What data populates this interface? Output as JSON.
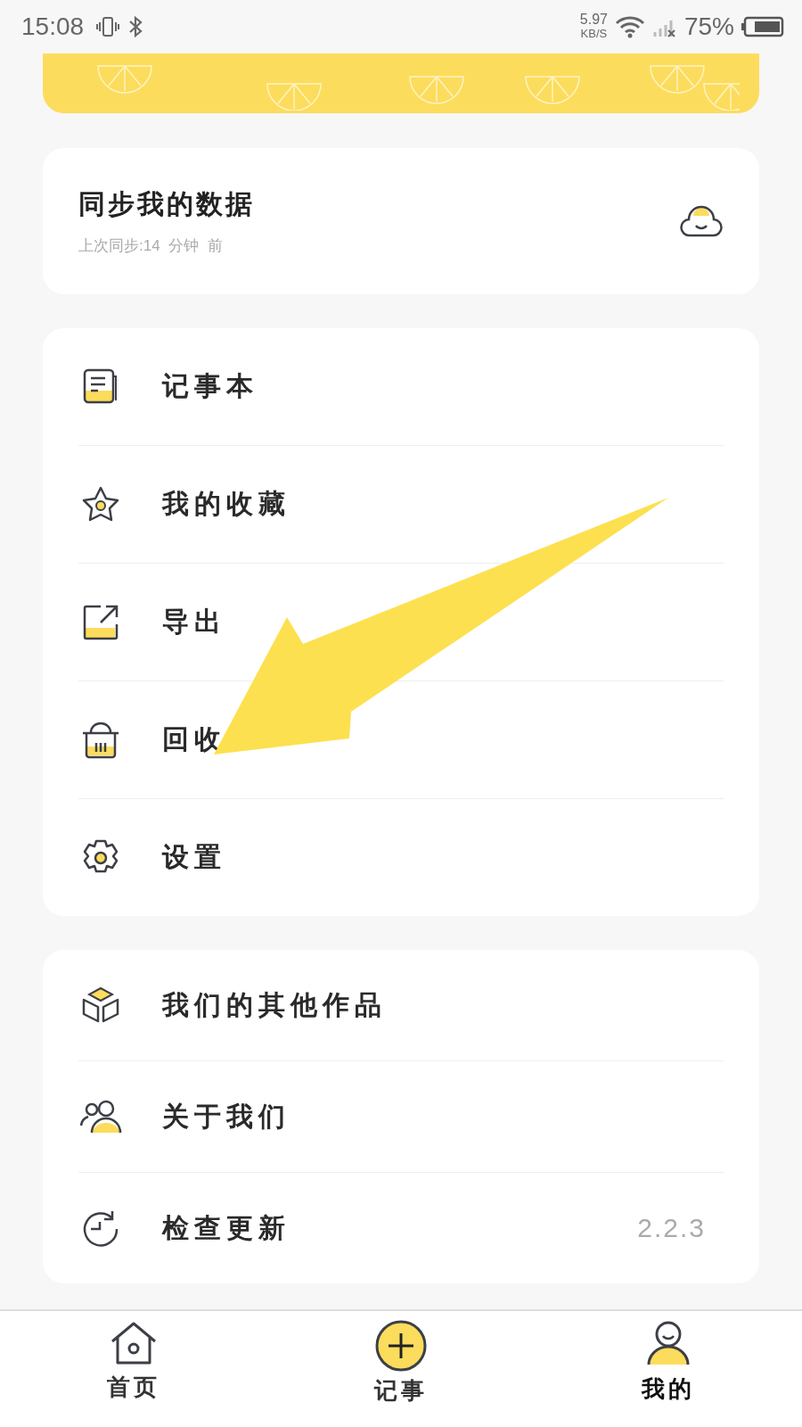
{
  "status_bar": {
    "time": "15:08",
    "net_speed": "5.97",
    "net_unit": "KB/S",
    "battery": "75%"
  },
  "sync_card": {
    "title": "同步我的数据",
    "subtitle": "上次同步:14  分钟  前"
  },
  "menu": [
    {
      "label": "记事本"
    },
    {
      "label": "我的收藏"
    },
    {
      "label": "导出"
    },
    {
      "label": "回收"
    },
    {
      "label": "设置"
    }
  ],
  "more_menu": [
    {
      "label": "我们的其他作品"
    },
    {
      "label": "关于我们"
    },
    {
      "label": "检查更新",
      "value": "2.2.3"
    }
  ],
  "bottom_nav": [
    {
      "kind": "home",
      "label": "首页",
      "selected": false
    },
    {
      "kind": "add",
      "label": "记事",
      "selected": false
    },
    {
      "kind": "me",
      "label": "我的",
      "selected": true
    }
  ]
}
